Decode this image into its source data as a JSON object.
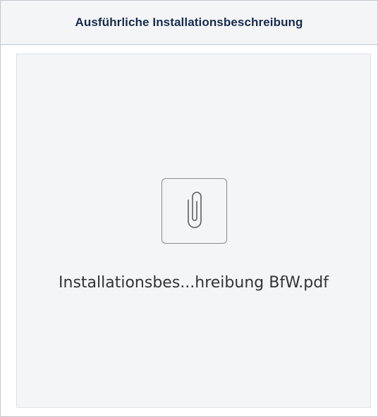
{
  "panel": {
    "title": "Ausführliche Installationsbeschreibung"
  },
  "attachment": {
    "file_name": "Installationsbes...hreibung BfW.pdf",
    "icon": "paperclip-icon"
  },
  "colors": {
    "header_bg": "#f4f5f7",
    "border": "#c1c7d0",
    "card_bg": "#f4f5f7",
    "text": "#333333"
  }
}
